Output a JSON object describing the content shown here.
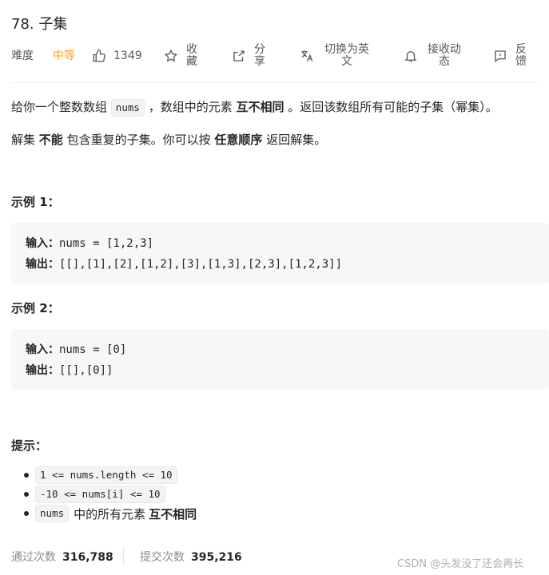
{
  "problem": {
    "title": "78. 子集"
  },
  "toolbar": {
    "difficulty_label": "难度",
    "difficulty_value": "中等",
    "likes": "1349",
    "favorite": "收藏",
    "share": "分享",
    "switch_lang": "切换为英文",
    "follow": "接收动态",
    "feedback": "反馈"
  },
  "description": {
    "p1_a": "给你一个整数数组",
    "p1_code": "nums",
    "p1_b": "，数组中的元素",
    "p1_bold": "互不相同",
    "p1_c": "。返回该数组所有可能的子集（幂集）。",
    "p2_a": "解集",
    "p2_bold1": "不能",
    "p2_b": "包含重复的子集。你可以按",
    "p2_bold2": "任意顺序",
    "p2_c": "返回解集。"
  },
  "examples": [
    {
      "title": "示例 1：",
      "input_label": "输入：",
      "input": "nums = [1,2,3]",
      "output_label": "输出：",
      "output": "[[],[1],[2],[1,2],[3],[1,3],[2,3],[1,2,3]]"
    },
    {
      "title": "示例 2：",
      "input_label": "输入：",
      "input": "nums = [0]",
      "output_label": "输出：",
      "output": "[[],[0]]"
    }
  ],
  "hints": {
    "title": "提示：",
    "items": [
      "1 <= nums.length <= 10",
      "-10 <= nums[i] <= 10"
    ],
    "item3_code": "nums",
    "item3_text": "中的所有元素",
    "item3_bold": "互不相同"
  },
  "stats": {
    "accepted_label": "通过次数",
    "accepted_value": "316,788",
    "submissions_label": "提交次数",
    "submissions_value": "395,216"
  },
  "watermark": "CSDN @头发没了还会再长",
  "colors": {
    "difficulty": "#ffa116",
    "code_bg": "#f7f7f8",
    "text": "#262626"
  },
  "icons": [
    "thumbs-up-icon",
    "star-icon",
    "share-icon",
    "translate-icon",
    "bell-icon",
    "feedback-icon"
  ]
}
